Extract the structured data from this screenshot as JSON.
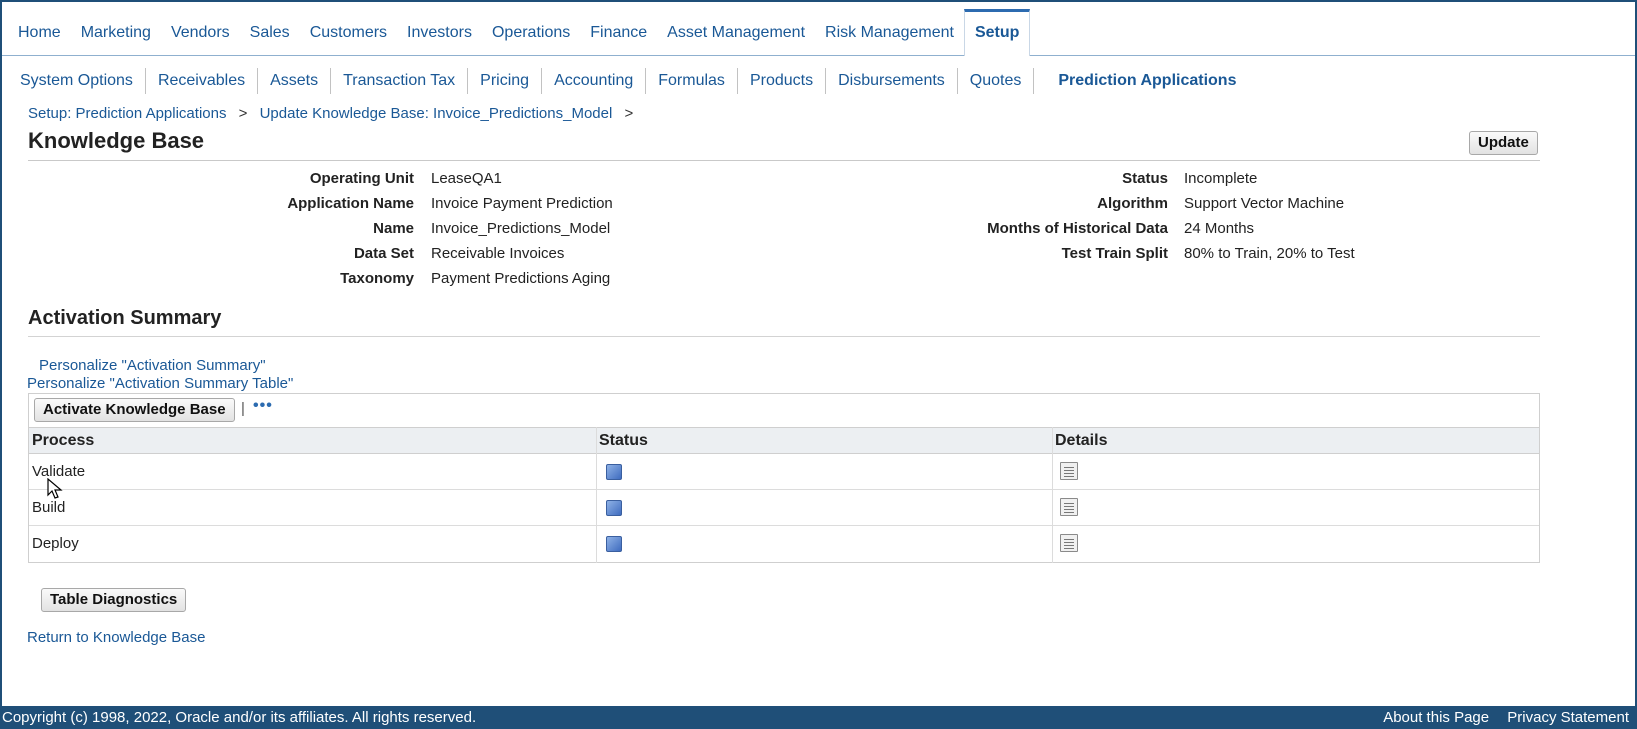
{
  "top_tabs": [
    "Home",
    "Marketing",
    "Vendors",
    "Sales",
    "Customers",
    "Investors",
    "Operations",
    "Finance",
    "Asset Management",
    "Risk Management",
    "Setup"
  ],
  "sub_tabs": [
    "System Options",
    "Receivables",
    "Assets",
    "Transaction Tax",
    "Pricing",
    "Accounting",
    "Formulas",
    "Products",
    "Disbursements",
    "Quotes",
    "Prediction Applications"
  ],
  "breadcrumb": {
    "item1": "Setup: Prediction Applications",
    "item2": "Update Knowledge Base: Invoice_Predictions_Model",
    "sep": ">"
  },
  "page_title": "Knowledge Base",
  "update_button": "Update",
  "details_left": [
    {
      "label": "Operating Unit",
      "value": "LeaseQA1"
    },
    {
      "label": "Application Name",
      "value": "Invoice Payment Prediction"
    },
    {
      "label": "Name",
      "value": "Invoice_Predictions_Model"
    },
    {
      "label": "Data Set",
      "value": "Receivable Invoices"
    },
    {
      "label": "Taxonomy",
      "value": "Payment Predictions Aging"
    }
  ],
  "details_right": [
    {
      "label": "Status",
      "value": "Incomplete"
    },
    {
      "label": "Algorithm",
      "value": "Support Vector Machine"
    },
    {
      "label": "Months of Historical Data",
      "value": "24 Months"
    },
    {
      "label": "Test Train Split",
      "value": "80% to Train, 20% to Test"
    }
  ],
  "activation": {
    "title": "Activation Summary",
    "personalize_summary": "Personalize \"Activation Summary\"",
    "personalize_table": "Personalize \"Activation Summary Table\"",
    "activate_button": "Activate Knowledge Base",
    "pipe": "|",
    "more": "•••",
    "columns": [
      "Process",
      "Status",
      "Details"
    ],
    "rows": [
      {
        "process": "Validate"
      },
      {
        "process": "Build"
      },
      {
        "process": "Deploy"
      }
    ]
  },
  "table_diagnostics_button": "Table Diagnostics",
  "return_link": "Return to Knowledge Base",
  "footer": {
    "copyright": "Copyright (c) 1998, 2022, Oracle and/or its affiliates. All rights reserved.",
    "about": "About this Page",
    "privacy": "Privacy Statement"
  },
  "colors": {
    "link": "#1a5896",
    "footer_bg": "#1f4f78",
    "status_icon": "#3f6cbf"
  },
  "icons": {
    "status": "status-square-icon",
    "details": "details-document-icon",
    "cursor": "mouse-pointer-icon"
  }
}
